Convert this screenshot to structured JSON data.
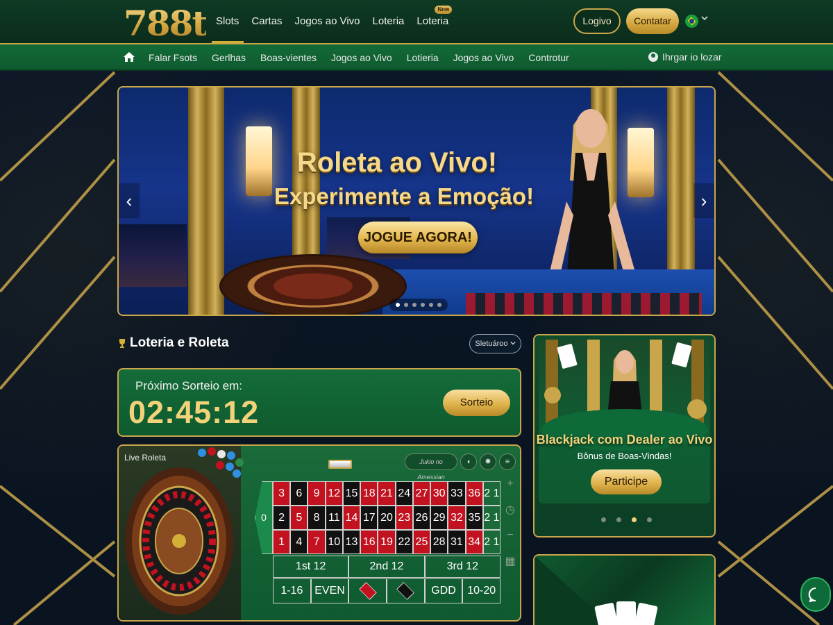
{
  "brand": {
    "logo": "788t"
  },
  "topnav": {
    "items": [
      {
        "label": "Slots",
        "active": true
      },
      {
        "label": "Cartas"
      },
      {
        "label": "Jogos ao Vivo"
      },
      {
        "label": "Loteria"
      },
      {
        "label": "Loteria",
        "badge": "Now"
      }
    ],
    "login_label": "Logivo",
    "contact_label": "Contatar",
    "language_flag": "brazil-flag-icon"
  },
  "subnav": {
    "home_icon": "home-icon",
    "items": [
      "Falar Fsots",
      "Gerlhas",
      "Boas-vientes",
      "Jogos ao Vivo",
      "Lotieria",
      "Jogos ao Vivo",
      "Controtur"
    ],
    "user_label": "Ihrgar io lozar"
  },
  "hero": {
    "title_line1": "Roleta ao Vivo!",
    "title_line2": "Experimente a Emoção!",
    "cta_label": "JOGUE AGORA!",
    "prev_icon": "‹",
    "next_icon": "›",
    "dots_total": 6,
    "dots_active_index": 0
  },
  "section": {
    "title": "Loteria e Roleta",
    "icon": "trophy-icon",
    "select_label": "Sletuároo"
  },
  "countdown": {
    "label": "Próximo Sorteio em:",
    "time": "02:45:12",
    "button_label": "Sorteio"
  },
  "live_roulette": {
    "label": "Live Roleta",
    "amount_pill": "Jukio no Amessian",
    "zero": "0",
    "rows": [
      [
        "3",
        "6",
        "9",
        "12",
        "15",
        "18",
        "21",
        "24",
        "27",
        "30",
        "33",
        "36",
        "2 1"
      ],
      [
        "2",
        "5",
        "8",
        "11",
        "14",
        "17",
        "20",
        "23",
        "26",
        "29",
        "32",
        "35",
        "2 1"
      ],
      [
        "1",
        "4",
        "7",
        "10",
        "13",
        "16",
        "19",
        "22",
        "25",
        "28",
        "31",
        "34",
        "2 1"
      ]
    ],
    "row_colors": [
      [
        "r",
        "b",
        "r",
        "r",
        "b",
        "r",
        "r",
        "b",
        "r",
        "r",
        "b",
        "r",
        "c"
      ],
      [
        "b",
        "r",
        "b",
        "b",
        "r",
        "b",
        "b",
        "r",
        "b",
        "b",
        "r",
        "b",
        "c"
      ],
      [
        "r",
        "b",
        "r",
        "b",
        "b",
        "r",
        "r",
        "b",
        "r",
        "b",
        "b",
        "r",
        "c"
      ]
    ],
    "dozens": [
      "1st 12",
      "2nd 12",
      "3rd 12"
    ],
    "outside": [
      "1-16",
      "EVEN",
      "",
      "",
      "GDD",
      "10-20"
    ],
    "red_color": "#c2121f",
    "black_color": "#111111"
  },
  "promo": {
    "title": "Blackjack com Dealer ao Vivo",
    "subtitle": "Bônus de Boas-Vindas!",
    "button_label": "Participe",
    "dots_total": 4,
    "dots_active_index": 2
  },
  "colors": {
    "gold": "#c9a64a",
    "green_dark": "#0b2d1c",
    "green": "#136b38"
  }
}
